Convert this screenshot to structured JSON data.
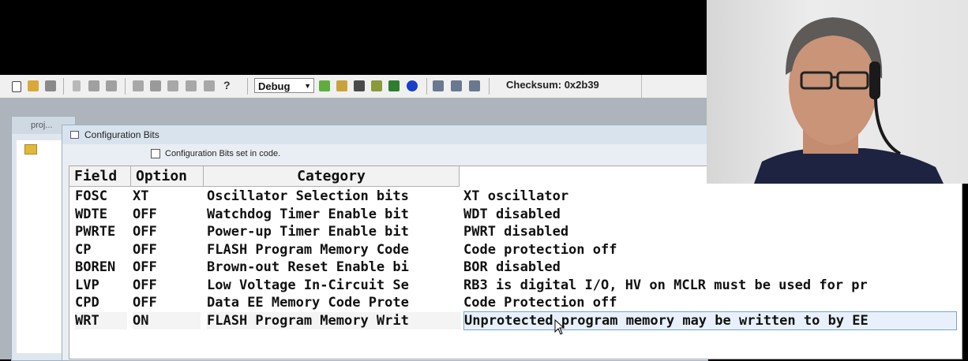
{
  "toolbar": {
    "config_select": "Debug",
    "checksum": "Checksum:  0x2b39"
  },
  "project_window": {
    "title": "proj..."
  },
  "config_window": {
    "title": "Configuration Bits",
    "checkbox_label": "Configuration Bits set in code.",
    "checkbox_checked": false,
    "columns": [
      "Field",
      "Option",
      "Category",
      ""
    ],
    "rows": [
      {
        "field": "FOSC",
        "option": "XT",
        "category": "Oscillator Selection bits",
        "setting": "XT oscillator"
      },
      {
        "field": "WDTE",
        "option": "OFF",
        "category": "Watchdog Timer Enable bit",
        "setting": "WDT disabled"
      },
      {
        "field": "PWRTE",
        "option": "OFF",
        "category": "Power-up Timer Enable bit",
        "setting": "PWRT disabled"
      },
      {
        "field": "CP",
        "option": "OFF",
        "category": "FLASH Program Memory Code",
        "setting": "Code protection off"
      },
      {
        "field": "BOREN",
        "option": "OFF",
        "category": "Brown-out Reset Enable bi",
        "setting": "BOR disabled"
      },
      {
        "field": "LVP",
        "option": "OFF",
        "category": "Low Voltage In-Circuit Se",
        "setting": "RB3 is digital I/O, HV on MCLR must be used for pr"
      },
      {
        "field": "CPD",
        "option": "OFF",
        "category": "Data EE Memory Code Prote",
        "setting": "Code Protection off"
      },
      {
        "field": "WRT",
        "option": "ON",
        "category": "FLASH Program Memory Writ",
        "setting": "Unprotected program memory may be written to by EE"
      }
    ],
    "selected_row": 7
  },
  "colors": {
    "toolbar_bg": "#f0f0f0",
    "mdi_bg": "#aeb4bb",
    "window_bg": "#e9eef4",
    "selection_border": "#7aa2cf"
  },
  "icons": [
    "new-file-icon",
    "open-folder-icon",
    "save-icon",
    "cut-icon",
    "copy-icon",
    "paste-icon",
    "print-icon",
    "find-icon",
    "bookmark-icon",
    "help-icon",
    "add-file-icon",
    "open-project-icon",
    "save-project-icon",
    "build-icon",
    "make-icon",
    "info-icon",
    "program-icon",
    "read-icon",
    "verify-icon",
    "mouse-cursor-icon"
  ]
}
